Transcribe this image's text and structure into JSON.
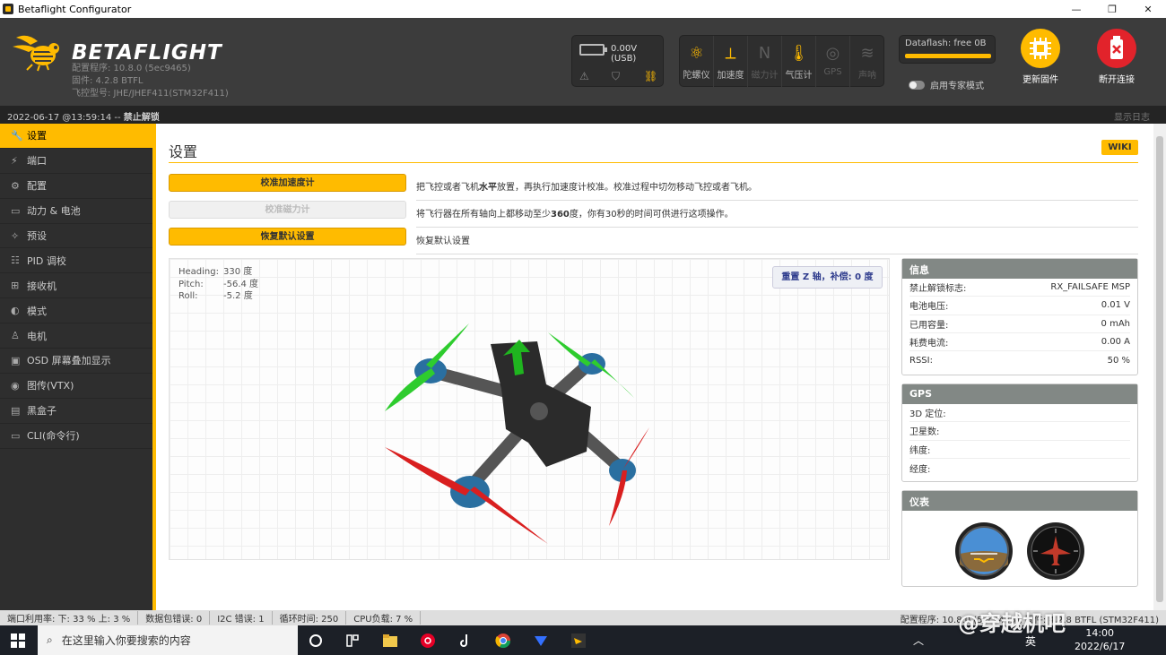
{
  "window": {
    "title": "Betaflight Configurator",
    "minimize": "—",
    "maximize": "❐",
    "close": "✕"
  },
  "header": {
    "brand": "BETAFLIGHT",
    "configurator_version": "配置程序: 10.8.0 (5ec9465)",
    "firmware_version": "固件: 4.2.8 BTFL",
    "board": "飞控型号: JHE/JHEF411(STM32F411)",
    "voltage": "0.00V (USB)",
    "sensors": [
      {
        "label": "陀螺仪",
        "icon": "gyro-icon",
        "active": true
      },
      {
        "label": "加速度",
        "icon": "accel-icon",
        "active": true
      },
      {
        "label": "磁力计",
        "icon": "mag-icon",
        "active": false
      },
      {
        "label": "气压计",
        "icon": "baro-icon",
        "active": true
      },
      {
        "label": "GPS",
        "icon": "gps-icon",
        "active": false
      },
      {
        "label": "声呐",
        "icon": "sonar-icon",
        "active": false
      }
    ],
    "dataflash": "Dataflash: free 0B",
    "expert_mode": "启用专家模式",
    "update_firmware": "更新固件",
    "disconnect": "断开连接"
  },
  "status": {
    "datetime": "2022-06-17 @13:59:14 -- ",
    "arming": "禁止解锁",
    "show_log": "显示日志"
  },
  "sidebar": {
    "items": [
      {
        "label": "设置",
        "icon": "wrench-icon",
        "active": true
      },
      {
        "label": "端口",
        "icon": "plug-icon"
      },
      {
        "label": "配置",
        "icon": "gear-icon"
      },
      {
        "label": "动力 & 电池",
        "icon": "battery-icon"
      },
      {
        "label": "预设",
        "icon": "magic-wand-icon"
      },
      {
        "label": "PID 调校",
        "icon": "sliders-icon"
      },
      {
        "label": "接收机",
        "icon": "receiver-icon"
      },
      {
        "label": "模式",
        "icon": "toggle-icon"
      },
      {
        "label": "电机",
        "icon": "motor-icon"
      },
      {
        "label": "OSD 屏幕叠加显示",
        "icon": "monitor-icon"
      },
      {
        "label": "图传(VTX)",
        "icon": "broadcast-icon"
      },
      {
        "label": "黑盒子",
        "icon": "blackbox-icon"
      },
      {
        "label": "CLI(命令行)",
        "icon": "terminal-icon"
      }
    ]
  },
  "main": {
    "title": "设置",
    "wiki": "WIKI",
    "actions": [
      {
        "button": "校准加速度计",
        "desc_pre": "把飞控或者飞机",
        "desc_bold": "水平",
        "desc_post": "放置，再执行加速度计校准。校准过程中切勿移动飞控或者飞机。",
        "enabled": true
      },
      {
        "button": "校准磁力计",
        "desc_pre": "将飞行器在所有轴向上都移动至少",
        "desc_bold": "360",
        "desc_post": "度，你有30秒的时间可供进行这项操作。",
        "enabled": false
      },
      {
        "button": "恢复默认设置",
        "desc_pre": "恢复默认设置",
        "desc_bold": "",
        "desc_post": "",
        "enabled": true
      }
    ],
    "attitude": {
      "heading_label": "Heading:",
      "heading": "330 度",
      "pitch_label": "Pitch:",
      "pitch": "-56.4 度",
      "roll_label": "Roll:",
      "roll": "-5.2 度"
    },
    "reset_z": "重置 Z 轴，补偿: 0 度"
  },
  "info": {
    "title": "信息",
    "rows": [
      {
        "k": "禁止解锁标志:",
        "v": "RX_FAILSAFE MSP"
      },
      {
        "k": "电池电压:",
        "v": "0.01 V"
      },
      {
        "k": "已用容量:",
        "v": "0 mAh"
      },
      {
        "k": "耗费电流:",
        "v": "0.00 A"
      },
      {
        "k": "RSSI:",
        "v": "50 %"
      }
    ]
  },
  "gps": {
    "title": "GPS",
    "rows": [
      {
        "k": "3D 定位:",
        "v": ""
      },
      {
        "k": "卫星数:",
        "v": ""
      },
      {
        "k": "纬度:",
        "v": ""
      },
      {
        "k": "经度:",
        "v": ""
      }
    ]
  },
  "instruments": {
    "title": "仪表"
  },
  "bottom": {
    "port_util": "端口利用率:  下: 33 % 上: 3 %",
    "packet_err": "数据包错误: 0",
    "i2c_err": "I2C 错误: 1",
    "cycle": "循环时间: 250",
    "cpu": "CPU负载: 7 %",
    "right": "配置程序: 10.8.0 (5ec9465), 固件: 4.2.8 BTFL (STM32F411)"
  },
  "taskbar": {
    "search_placeholder": "在这里输入你要搜索的内容",
    "time": "14:00",
    "date": "2022/6/17",
    "ime": "英"
  },
  "watermark": "@穿越机吧",
  "colors": {
    "accent": "#ffbb00",
    "header": "#3c3c3c",
    "sidebar": "#2e2e2e"
  }
}
